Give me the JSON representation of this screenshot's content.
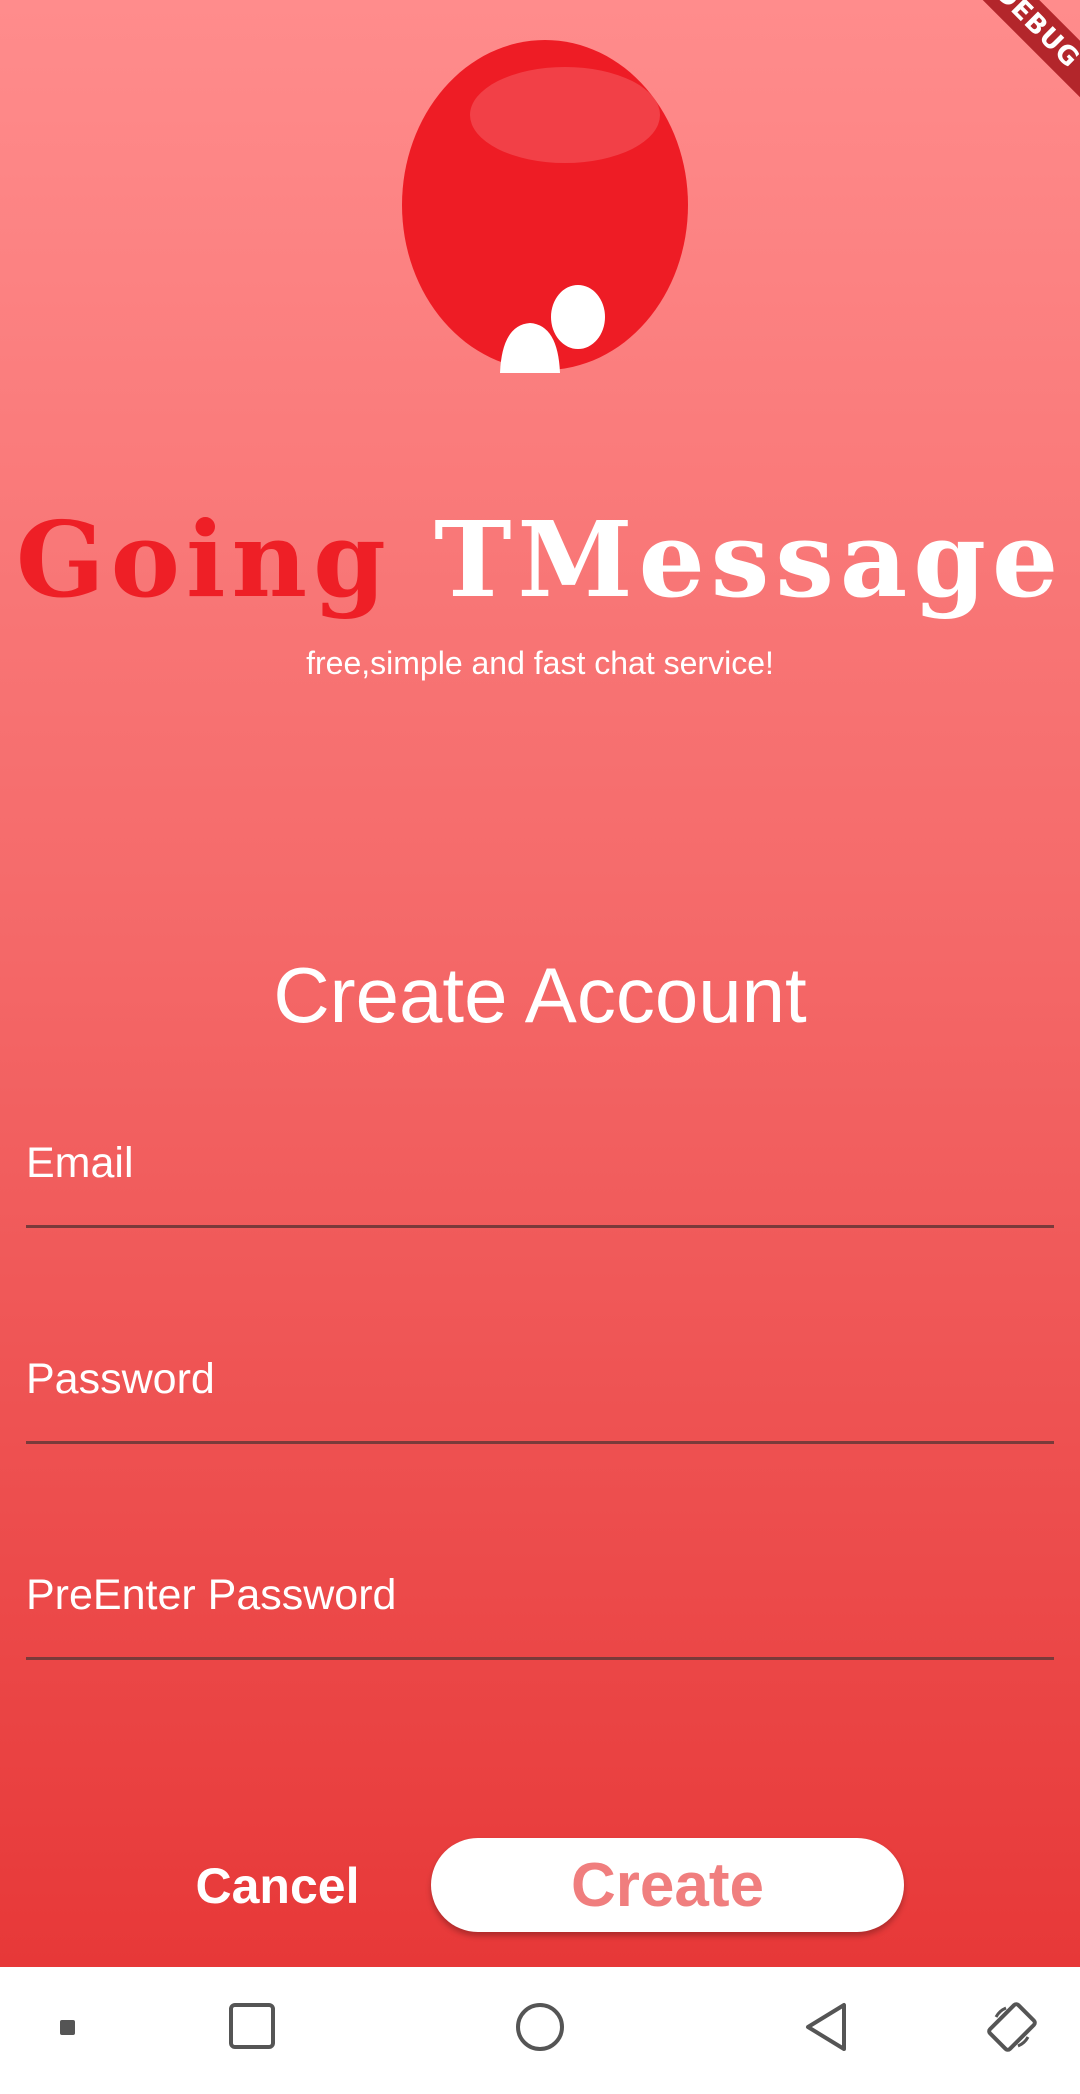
{
  "app": {
    "title_part1": "Going",
    "title_part2": "TMessage",
    "tagline": "free,simple and fast chat service!",
    "debug_banner": "DEBUG"
  },
  "form": {
    "heading": "Create Account",
    "email_label": "Email",
    "password_label": "Password",
    "confirm_label": "PreEnter Password"
  },
  "actions": {
    "cancel_label": "Cancel",
    "create_label": "Create"
  },
  "navbar": {
    "icons": [
      "dot-icon",
      "square-icon",
      "home-circle-icon",
      "back-triangle-icon",
      "rotate-icon"
    ]
  },
  "colors": {
    "gradient_top": "#ff8c8c",
    "gradient_bottom": "#e73838",
    "brand_red": "#ee1f26",
    "create_text": "#f07e7e"
  }
}
